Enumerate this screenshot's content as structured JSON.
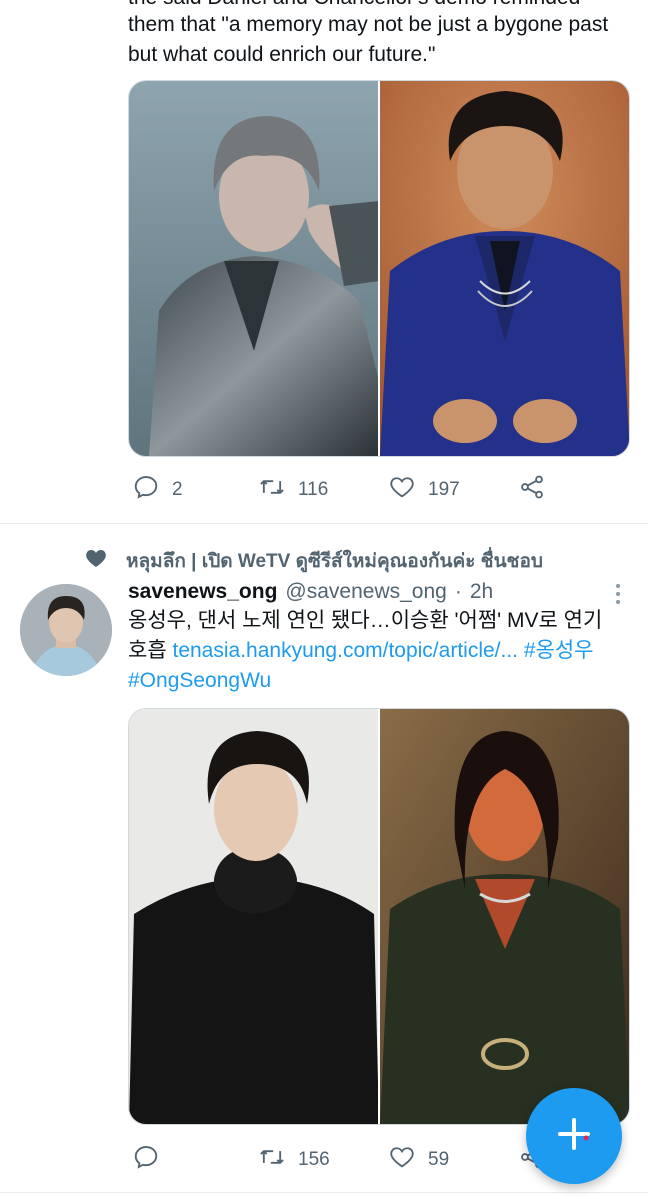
{
  "tweet1": {
    "text_cut": "the said Daniel and Chancellor's demo reminded",
    "text": "them that \"a memory may not be just a bygone past but what could enrich our future.\"",
    "replies": "2",
    "retweets": "116",
    "likes": "197"
  },
  "social_context": "หลุมลึก | เปิด WeTV ดูซีรีส์ใหม่คุณองกันค่ะ ชื่นชอบ",
  "tweet2": {
    "name": "savenews_ong",
    "handle": "@savenews_ong",
    "separator": "·",
    "time": "2h",
    "text": "옹성우, 댄서 노제 연인 됐다…이승환 '어쩜' MV로 연기 호흡",
    "link": "tenasia.hankyung.com/topic/article/...",
    "hashtag1": "#옹성우",
    "hashtag2": "#OngSeongWu",
    "replies": "",
    "retweets": "156",
    "likes": "59"
  },
  "icons": [
    "reply-icon",
    "retweet-icon",
    "like-icon",
    "share-icon",
    "heart-icon",
    "more-icon",
    "compose-plus-icon"
  ],
  "colors": {
    "accent": "#1d9bf0",
    "muted": "#536471"
  }
}
